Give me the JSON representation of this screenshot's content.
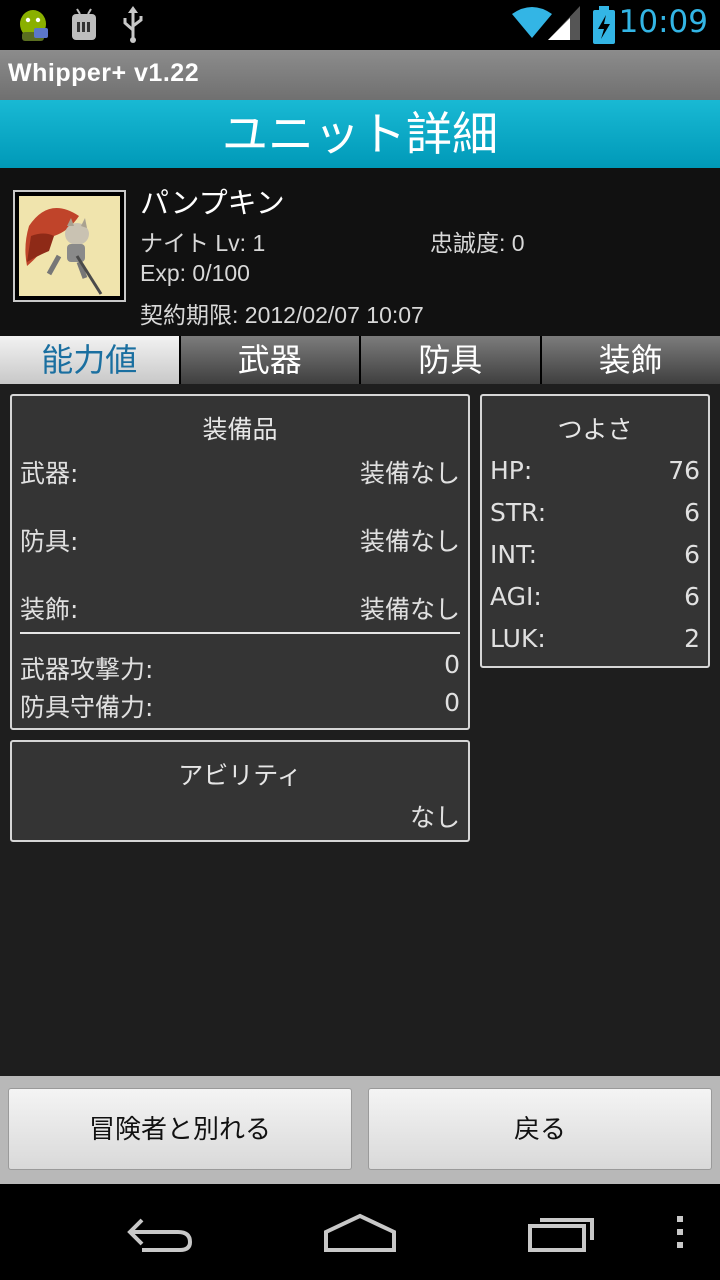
{
  "status_bar": {
    "time": "10:09",
    "icons": [
      "android-debug-icon",
      "android-sdcard-icon",
      "usb-icon",
      "wifi-icon",
      "signal-icon",
      "battery-charging-icon"
    ]
  },
  "app": {
    "title": "Whipper+   v1.22"
  },
  "screen": {
    "title": "ユニット詳細"
  },
  "unit": {
    "name": "パンプキン",
    "class_level": "ナイト Lv: 1",
    "loyalty": "忠誠度: 0",
    "exp": "Exp: 0/100",
    "contract": "契約期限: 2012/02/07  10:07"
  },
  "tabs": [
    {
      "label": "能力値",
      "active": true
    },
    {
      "label": "武器",
      "active": false
    },
    {
      "label": "防具",
      "active": false
    },
    {
      "label": "装飾",
      "active": false
    }
  ],
  "equipment": {
    "title": "装備品",
    "rows": [
      {
        "key": "武器:",
        "value": "装備なし"
      },
      {
        "key": "防具:",
        "value": "装備なし"
      },
      {
        "key": "装飾:",
        "value": "装備なし"
      }
    ],
    "stats": [
      {
        "key": "武器攻撃力:",
        "value": "0"
      },
      {
        "key": "防具守備力:",
        "value": "0"
      }
    ]
  },
  "strength": {
    "title": "つよさ",
    "rows": [
      {
        "key": "HP:",
        "value": "76"
      },
      {
        "key": "STR:",
        "value": "6"
      },
      {
        "key": "INT:",
        "value": "6"
      },
      {
        "key": "AGI:",
        "value": "6"
      },
      {
        "key": "LUK:",
        "value": "2"
      }
    ]
  },
  "ability": {
    "title": "アビリティ",
    "value": "なし"
  },
  "buttons": {
    "leave": "冒険者と別れる",
    "back": "戻る"
  },
  "colors": {
    "accent": "#33b5e5",
    "header": "#0aa7c6",
    "active_tab_text": "#1a6fa0"
  }
}
